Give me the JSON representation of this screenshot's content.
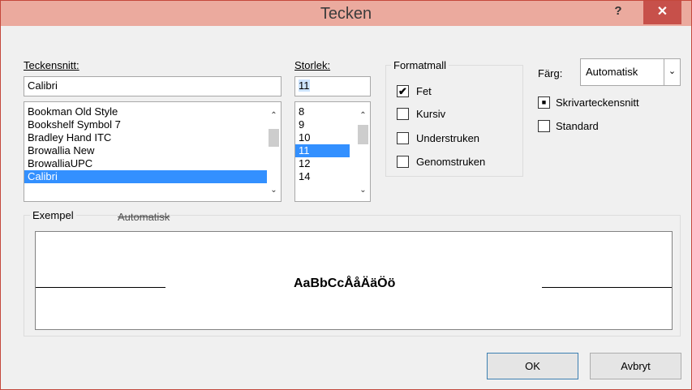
{
  "window": {
    "title": "Tecken",
    "help_label": "?",
    "close_label": "✕",
    "colors": {
      "titlebar": "#ebaa9e",
      "close": "#c7504a",
      "selection": "#3390ff"
    }
  },
  "font": {
    "label": "Teckensnitt:",
    "value": "Calibri",
    "items": [
      "Bookman Old Style",
      "Bookshelf Symbol 7",
      "Bradley Hand ITC",
      "Browallia New",
      "BrowalliaUPC",
      "Calibri"
    ],
    "selected_index": 5
  },
  "size": {
    "label": "Storlek:",
    "value": "11",
    "items": [
      "8",
      "9",
      "10",
      "11",
      "12",
      "14"
    ],
    "selected_index": 3
  },
  "style": {
    "label": "Formatmall",
    "options": [
      {
        "label": "Fet",
        "checked": true
      },
      {
        "label": "Kursiv",
        "checked": false
      },
      {
        "label": "Understruken",
        "checked": false
      },
      {
        "label": "Genomstruken",
        "checked": false
      }
    ]
  },
  "color": {
    "label": "Färg:",
    "value": "Automatisk",
    "options": [
      {
        "label": "Skrivarteckensnitt",
        "checked": true
      },
      {
        "label": "Standard",
        "checked": false
      }
    ]
  },
  "preview": {
    "label": "Exempel",
    "overlay_text": "Automatisk",
    "sample_text": "AaBbCcÅåÄäÖö"
  },
  "buttons": {
    "ok": "OK",
    "cancel": "Avbryt"
  },
  "icons": {
    "scroll_up": "chevron-up-icon",
    "scroll_down": "chevron-down-icon",
    "dropdown": "chevron-down-icon",
    "check": "check-icon"
  }
}
